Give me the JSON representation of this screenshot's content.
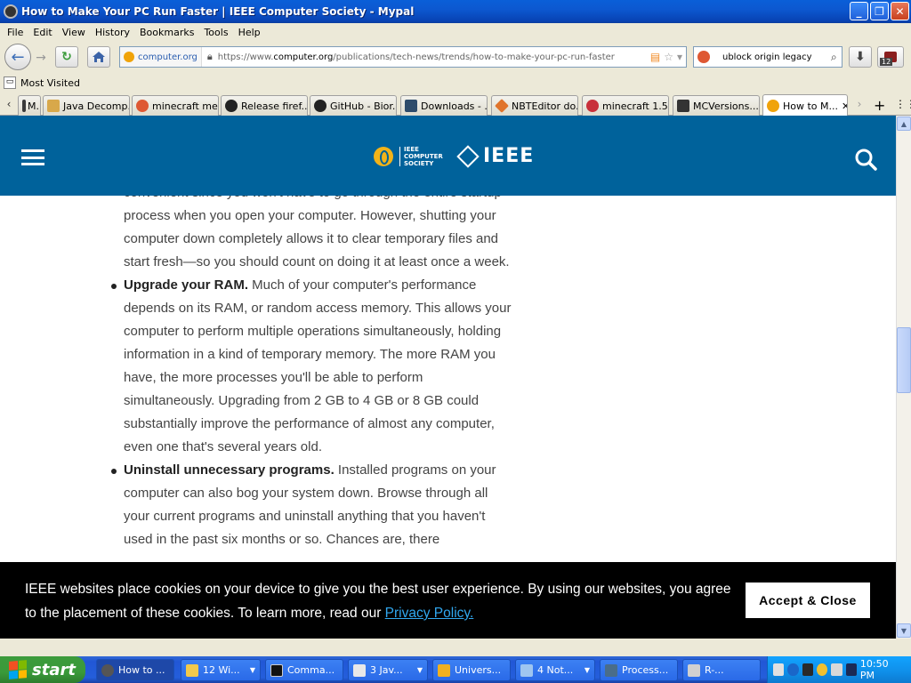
{
  "window": {
    "title": "How to Make Your PC Run Faster | IEEE Computer Society - Mypal",
    "minimize": "_",
    "restore": "❐",
    "close": "✕"
  },
  "menu": [
    "File",
    "Edit",
    "View",
    "History",
    "Bookmarks",
    "Tools",
    "Help"
  ],
  "nav": {
    "site_identity": "computer.org",
    "url_prefix": "https://www.",
    "url_domain": "computer.org",
    "url_path": "/publications/tech-news/trends/how-to-make-your-pc-run-faster",
    "search_value": "ublock origin legacy",
    "downloads_badge": "12"
  },
  "bookmarks": {
    "most_visited": "Most Visited"
  },
  "tabs": [
    {
      "label": "M...",
      "fav": "#3a3a3a"
    },
    {
      "label": "Java Decomp...",
      "fav": "#d8a84a"
    },
    {
      "label": "minecraft me...",
      "fav": "#de5833"
    },
    {
      "label": "Release firef...",
      "fav": "#222222"
    },
    {
      "label": "GitHub - Bior...",
      "fav": "#222222"
    },
    {
      "label": "Downloads - ...",
      "fav": "#2d4b6b"
    },
    {
      "label": "NBTEditor do...",
      "fav": "#e0742c"
    },
    {
      "label": "minecraft 1.5...",
      "fav": "#c8303a"
    },
    {
      "label": "MCVersions....",
      "fav": "#333333"
    },
    {
      "label": "How to M...",
      "fav": "#f0a30a",
      "active": true
    }
  ],
  "article": {
    "intro_line": "convenient since you won't have to go through the entire startup",
    "intro_rest": "process when you open your computer. However, shutting your computer down completely allows it to clear temporary files and start fresh—so you should count on doing it at least once a week.",
    "items": [
      {
        "title": "Upgrade your RAM.",
        "text": " Much of your computer's performance depends on its RAM, or random access memory. This allows your computer to perform multiple operations simultaneously, holding information in a kind of temporary memory. The more RAM you have, the more processes you'll be able to perform simultaneously. Upgrading from 2 GB to 4 GB or 8 GB could substantially improve the performance of almost any computer, even one that's several years old."
      },
      {
        "title": "Uninstall unnecessary programs.",
        "text": " Installed programs on your computer can also bog your system down. Browse through all your current programs and uninstall anything that you haven't used in the past six months or so. Chances are, there"
      }
    ]
  },
  "cookie": {
    "text": "IEEE websites place cookies on your device to give you the best user experience. By using our websites, you agree to the placement of these cookies. To learn more, read our ",
    "link": "Privacy Policy.",
    "button": "Accept & Close"
  },
  "logos": {
    "cs_line1": "IEEE",
    "cs_line2": "COMPUTER",
    "cs_line3": "SOCIETY",
    "ieee": "IEEE"
  },
  "taskbar": {
    "start": "start",
    "tasks": [
      {
        "label": "How to ...",
        "active": true,
        "icon": "#555555"
      },
      {
        "label": "12 Wi...",
        "arrow": true,
        "icon": "#f2c94c"
      },
      {
        "label": "Comma...",
        "icon": "#111111"
      },
      {
        "label": "3 Jav...",
        "arrow": true,
        "icon": "#e8e8e8"
      },
      {
        "label": "Univers...",
        "icon": "#f0b020"
      },
      {
        "label": "4 Not...",
        "arrow": true,
        "icon": "#9ec5f0"
      },
      {
        "label": "Process...",
        "icon": "#4a6d8a"
      },
      {
        "label": "R-...",
        "icon": "#d0d0d0"
      }
    ],
    "clock": "10:50 PM"
  },
  "colors": {
    "ieee_blue": "#00629b",
    "link_blue": "#31a8f0",
    "xp_blue": "#245edb",
    "start_green": "#3a9a3a"
  }
}
